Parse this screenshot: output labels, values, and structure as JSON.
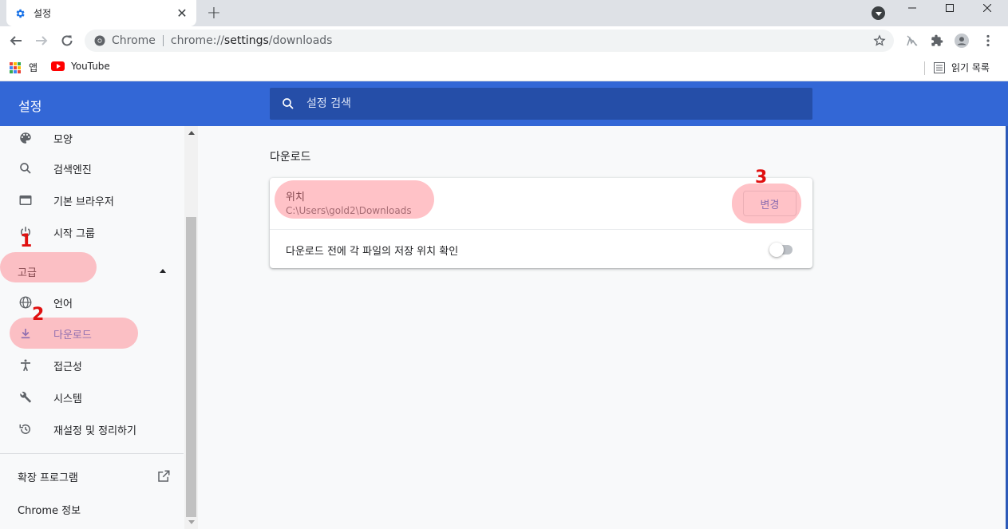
{
  "tab": {
    "title": "설정"
  },
  "omnibox": {
    "site": "Chrome",
    "url_prefix": "chrome://",
    "url_host": "settings",
    "url_path": "/downloads"
  },
  "bookmarks": {
    "apps": "앱",
    "youtube": "YouTube",
    "reading_list": "읽기 목록"
  },
  "header": {
    "title": "설정",
    "search_placeholder": "설정 검색"
  },
  "sidebar": {
    "items_top": [
      {
        "label": "모양"
      },
      {
        "label": "검색엔진"
      },
      {
        "label": "기본 브라우저"
      },
      {
        "label": "시작 그룹"
      }
    ],
    "advanced": "고급",
    "items_adv": [
      {
        "label": "언어"
      },
      {
        "label": "다운로드"
      },
      {
        "label": "접근성"
      },
      {
        "label": "시스템"
      },
      {
        "label": "재설정 및 정리하기"
      }
    ],
    "extensions": "확장 프로그램",
    "about": "Chrome 정보"
  },
  "main": {
    "section_title": "다운로드",
    "location_label": "위치",
    "location_path": "C:\\Users\\gold2\\Downloads",
    "change_button": "변경",
    "ask_label": "다운로드 전에 각 파일의 저장 위치 확인",
    "ask_enabled": false
  },
  "annotations": {
    "n1": "1",
    "n2": "2",
    "n3": "3"
  },
  "colors": {
    "header": "#3367d6",
    "search": "#254ea8",
    "accent": "#3367d6",
    "highlight": "#ff7882"
  }
}
